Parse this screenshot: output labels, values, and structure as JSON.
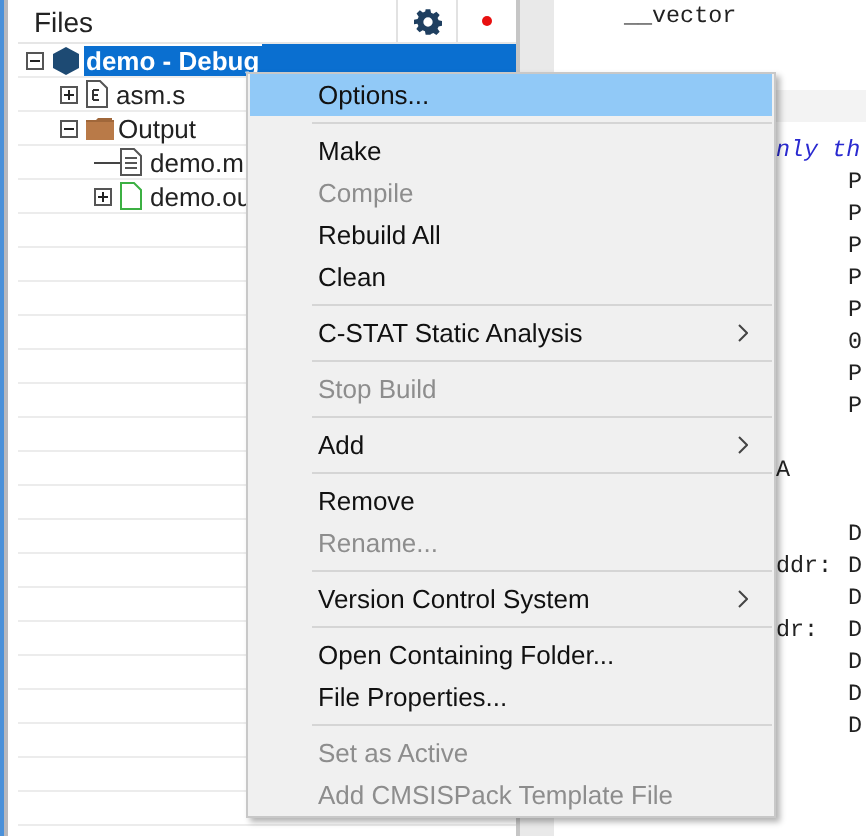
{
  "files_panel": {
    "title": "Files",
    "tree": [
      {
        "name": "demo - Debug",
        "kind": "project",
        "selected": true,
        "expanded": true,
        "children": [
          {
            "name": "asm.s",
            "kind": "source",
            "selected": false,
            "expanded": false
          },
          {
            "name": "Output",
            "kind": "folder",
            "selected": false,
            "expanded": true,
            "children": [
              {
                "name": "demo.m",
                "kind": "document",
                "selected": false
              },
              {
                "name": "demo.ou",
                "kind": "output",
                "selected": false,
                "expanded": false
              }
            ]
          }
        ]
      }
    ]
  },
  "editor": {
    "top_line": "__vector",
    "lines": [
      {
        "kind": "comment",
        "label": "nly th"
      },
      {
        "kind": "code",
        "operand": "P"
      },
      {
        "kind": "code",
        "operand": "P"
      },
      {
        "kind": "code",
        "operand": "P"
      },
      {
        "kind": "code",
        "operand": "P"
      },
      {
        "kind": "code",
        "operand": "P"
      },
      {
        "kind": "code",
        "operand": "0"
      },
      {
        "kind": "code",
        "operand": "P"
      },
      {
        "kind": "code",
        "operand": "P"
      },
      {
        "kind": "blank"
      },
      {
        "kind": "code",
        "label": "A"
      },
      {
        "kind": "blank"
      },
      {
        "kind": "code",
        "operand": "D"
      },
      {
        "kind": "code",
        "label": "ddr:",
        "operand": "D"
      },
      {
        "kind": "code",
        "operand": "D"
      },
      {
        "kind": "code",
        "label": "dr:",
        "operand": "D"
      },
      {
        "kind": "code",
        "operand": "D"
      },
      {
        "kind": "code",
        "operand": "D"
      },
      {
        "kind": "code",
        "operand": "D"
      }
    ]
  },
  "context_menu": [
    {
      "kind": "item",
      "label": "Options...",
      "highlighted": true,
      "disabled": false,
      "submenu": false
    },
    {
      "kind": "separator"
    },
    {
      "kind": "item",
      "label": "Make",
      "highlighted": false,
      "disabled": false,
      "submenu": false
    },
    {
      "kind": "item",
      "label": "Compile",
      "highlighted": false,
      "disabled": true,
      "submenu": false
    },
    {
      "kind": "item",
      "label": "Rebuild All",
      "highlighted": false,
      "disabled": false,
      "submenu": false
    },
    {
      "kind": "item",
      "label": "Clean",
      "highlighted": false,
      "disabled": false,
      "submenu": false
    },
    {
      "kind": "separator"
    },
    {
      "kind": "item",
      "label": "C-STAT Static Analysis",
      "highlighted": false,
      "disabled": false,
      "submenu": true
    },
    {
      "kind": "separator"
    },
    {
      "kind": "item",
      "label": "Stop Build",
      "highlighted": false,
      "disabled": true,
      "submenu": false
    },
    {
      "kind": "separator"
    },
    {
      "kind": "item",
      "label": "Add",
      "highlighted": false,
      "disabled": false,
      "submenu": true
    },
    {
      "kind": "separator"
    },
    {
      "kind": "item",
      "label": "Remove",
      "highlighted": false,
      "disabled": false,
      "submenu": false
    },
    {
      "kind": "item",
      "label": "Rename...",
      "highlighted": false,
      "disabled": true,
      "submenu": false
    },
    {
      "kind": "separator"
    },
    {
      "kind": "item",
      "label": "Version Control System",
      "highlighted": false,
      "disabled": false,
      "submenu": true
    },
    {
      "kind": "separator"
    },
    {
      "kind": "item",
      "label": "Open Containing Folder...",
      "highlighted": false,
      "disabled": false,
      "submenu": false
    },
    {
      "kind": "item",
      "label": "File Properties...",
      "highlighted": false,
      "disabled": false,
      "submenu": false
    },
    {
      "kind": "separator"
    },
    {
      "kind": "item",
      "label": "Set as Active",
      "highlighted": false,
      "disabled": true,
      "submenu": false
    },
    {
      "kind": "item",
      "label": "Add CMSISPack Template File",
      "highlighted": false,
      "disabled": true,
      "submenu": false
    }
  ]
}
